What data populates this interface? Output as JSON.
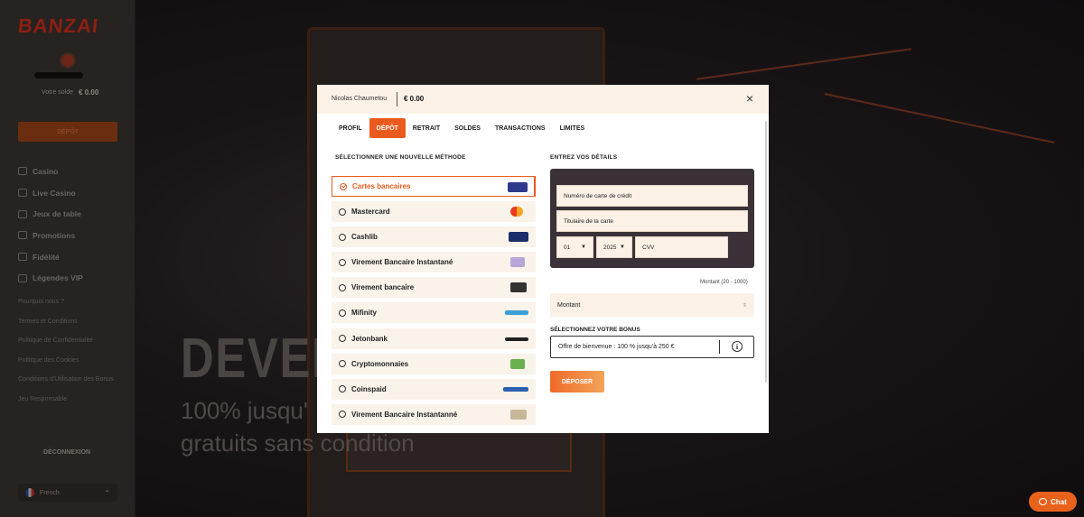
{
  "sidebar": {
    "logo": "BANZAI",
    "balance_label": "Votre solde",
    "balance_value": "€ 0.00",
    "deposit_label": "DÉPÔT",
    "nav": [
      {
        "label": "Casino",
        "icon": "grid-icon"
      },
      {
        "label": "Live Casino",
        "icon": "camera-icon"
      },
      {
        "label": "Jeux de table",
        "icon": "cards-icon"
      },
      {
        "label": "Promotions",
        "icon": "gift-icon"
      },
      {
        "label": "Fidélité",
        "icon": "diamond-icon"
      },
      {
        "label": "Légendes VIP",
        "icon": "crown-icon"
      }
    ],
    "links": [
      "Pourquoi nous ?",
      "Termes et Conditions",
      "Politique de Confidentialité",
      "Politique des Cookies",
      "Conditions d'Utilisation des Bonus",
      "Jeu Responsable"
    ],
    "logout_label": "DÉCONNEXION",
    "language": "French"
  },
  "background": {
    "headline": "DEVENI",
    "sub1": "100% jusqu'",
    "sub2": "gratuits sans condition"
  },
  "chat": {
    "label": "Chat"
  },
  "modal": {
    "user": "Nicolas Chaumetou",
    "balance": "€ 0.00",
    "tabs": [
      {
        "label": "PROFIL",
        "active": false
      },
      {
        "label": "DÉPÔT",
        "active": true
      },
      {
        "label": "RETRAIT",
        "active": false
      },
      {
        "label": "SOLDES",
        "active": false
      },
      {
        "label": "TRANSACTIONS",
        "active": false
      },
      {
        "label": "LIMITES",
        "active": false
      }
    ],
    "methods_title": "SÉLECTIONNER UNE NOUVELLE MÉTHODE",
    "details_title": "ENTREZ VOS DÉTAILS",
    "methods": [
      {
        "label": "Cartes bancaires",
        "selected": true,
        "logo_color": "#2e3a8c"
      },
      {
        "label": "Mastercard",
        "selected": false,
        "logo_color": "#eb5b1e"
      },
      {
        "label": "Cashlib",
        "selected": false,
        "logo_color": "#1b2e6a"
      },
      {
        "label": "Virement Bancaire Instantané",
        "selected": false,
        "logo_color": "#b7a6d8"
      },
      {
        "label": "Virement bancaire",
        "selected": false,
        "logo_color": "#333333"
      },
      {
        "label": "Mifinity",
        "selected": false,
        "logo_color": "#3aa0d8"
      },
      {
        "label": "Jetonbank",
        "selected": false,
        "logo_color": "#222222"
      },
      {
        "label": "Cryptomonnaies",
        "selected": false,
        "logo_color": "#6ab04c"
      },
      {
        "label": "Coinspaid",
        "selected": false,
        "logo_color": "#2b5fb0"
      },
      {
        "label": "Virement Bancaire Instantanné",
        "selected": false,
        "logo_color": "#c9b79a"
      }
    ],
    "card": {
      "number_placeholder": "Numéro de carte de crédit",
      "holder_placeholder": "Titulaire de la carte",
      "month": "01",
      "year": "2025",
      "cvv_placeholder": "CVV"
    },
    "amount_label": "Montant (20 - 1000)",
    "amount_placeholder": "Montant",
    "bonus_title": "SÉLECTIONNEZ VOTRE BONUS",
    "bonus_value": "Offre de bienvenue : 100 % jusqu'à 250 €",
    "deposit_button": "DÉPOSER",
    "accent_color": "#ea5a1c"
  }
}
